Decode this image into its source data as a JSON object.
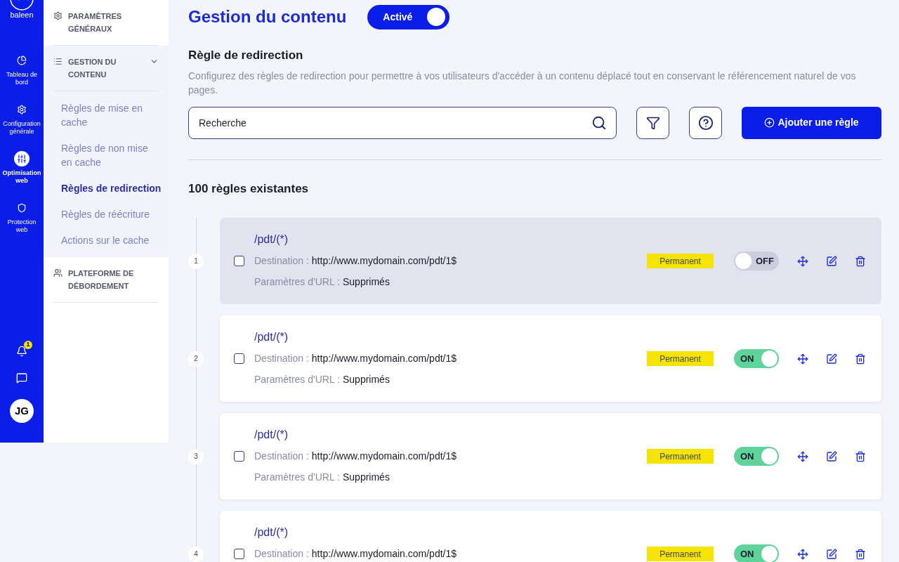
{
  "rail": {
    "logo": "baleen",
    "items": [
      {
        "label": "Tableau de bord",
        "selected": false
      },
      {
        "label": "Configuration générale",
        "selected": false
      },
      {
        "label": "Optimisation web",
        "selected": true
      },
      {
        "label": "Protection web",
        "selected": false
      }
    ],
    "notifications": "1",
    "avatar": "JG"
  },
  "sidebar": {
    "sections": [
      {
        "label": "PARAMÈTRES GÉNÉRAUX",
        "expanded": false
      },
      {
        "label": "GESTION DU CONTENU",
        "expanded": true,
        "children": [
          {
            "label": "Règles de mise en cache",
            "selected": false
          },
          {
            "label": "Règles de non mise en cache",
            "selected": false
          },
          {
            "label": "Règles de redirection",
            "selected": true
          },
          {
            "label": "Règles de réécriture",
            "selected": false
          },
          {
            "label": "Actions sur le cache",
            "selected": false
          }
        ]
      },
      {
        "label": "PLATEFORME DE DÉBORDEMENT",
        "expanded": false
      }
    ]
  },
  "header": {
    "title": "Gestion du contenu",
    "toggle": {
      "label": "Activé",
      "on": true
    }
  },
  "section": {
    "title": "Règle de redirection",
    "description": "Configurez des règles de redirection pour permettre à vos utilisateurs d'accéder à un contenu déplacé tout en conservant le référencement naturel de vos pages."
  },
  "search": {
    "placeholder": "Recherche"
  },
  "add_button": "Ajouter une règle",
  "count": "100 règles existantes",
  "rules": [
    {
      "number": "1",
      "path": "/pdt/(*)",
      "destination_label": "Destination :",
      "destination": "http://www.mydomain.com/pdt/1$",
      "params_label": "Paramètres d'URL :",
      "params": "Supprimés",
      "tag": "Permanent",
      "toggle": "OFF",
      "on": false,
      "checked": false
    },
    {
      "number": "2",
      "path": "/pdt/(*)",
      "destination_label": "Destination :",
      "destination": "http://www.mydomain.com/pdt/1$",
      "params_label": "Paramètres d'URL :",
      "params": "Supprimés",
      "tag": "Permanent",
      "toggle": "ON",
      "on": true,
      "checked": false
    },
    {
      "number": "3",
      "path": "/pdt/(*)",
      "destination_label": "Destination :",
      "destination": "http://www.mydomain.com/pdt/1$",
      "params_label": "Paramètres d'URL :",
      "params": "Supprimés",
      "tag": "Permanent",
      "toggle": "ON",
      "on": true,
      "checked": false
    },
    {
      "number": "4",
      "path": "/pdt/(*)",
      "destination_label": "Destination :",
      "destination": "http://www.mydomain.com/pdt/1$",
      "tag": "Permanent",
      "toggle": "ON",
      "on": true,
      "checked": false
    }
  ]
}
